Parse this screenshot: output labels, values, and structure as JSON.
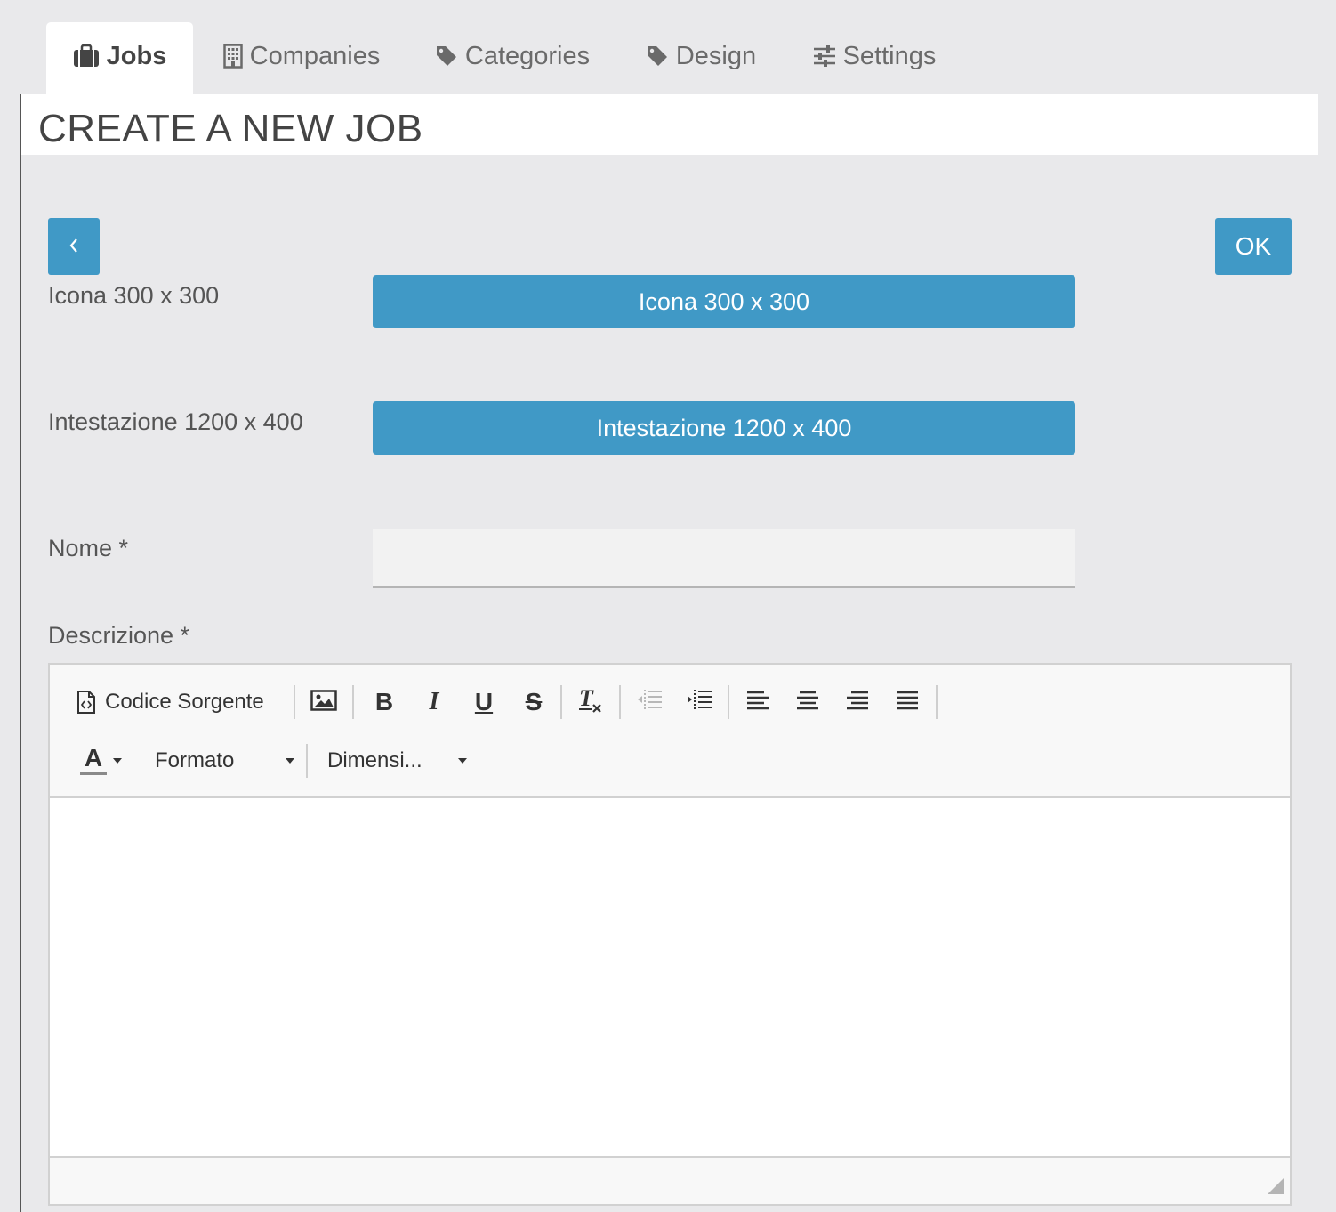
{
  "tabs": [
    {
      "label": "Jobs",
      "icon": "briefcase-icon",
      "active": true
    },
    {
      "label": "Companies",
      "icon": "building-icon",
      "active": false
    },
    {
      "label": "Categories",
      "icon": "tag-icon",
      "active": false
    },
    {
      "label": "Design",
      "icon": "tag-icon",
      "active": false
    },
    {
      "label": "Settings",
      "icon": "sliders-icon",
      "active": false
    }
  ],
  "page": {
    "title": "CREATE A NEW JOB"
  },
  "nav": {
    "back_label": "‹",
    "ok_label": "OK"
  },
  "form": {
    "icon_label": "Icona 300 x 300",
    "icon_button": "Icona 300 x 300",
    "header_label": "Intestazione 1200 x 400",
    "header_button": "Intestazione 1200 x 400",
    "name_label": "Nome *",
    "name_value": "",
    "description_label": "Descrizione *"
  },
  "editor": {
    "source_label": "Codice Sorgente",
    "format_label": "Formato",
    "size_label": "Dimensi...",
    "font_color_letter": "A",
    "content": ""
  },
  "colors": {
    "accent": "#4099c6",
    "background": "#e9e9eb"
  }
}
